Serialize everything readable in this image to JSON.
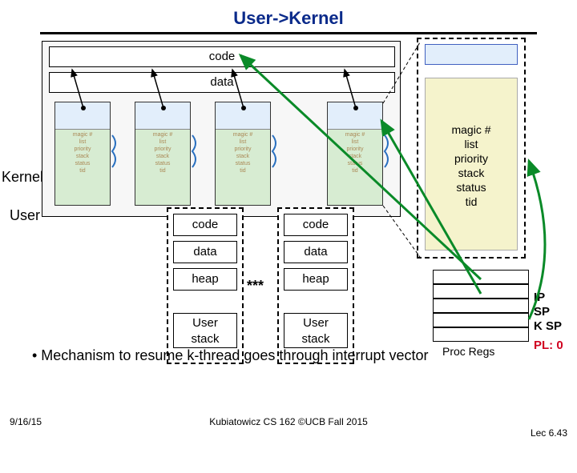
{
  "title": "User->Kernel",
  "kernel_top": {
    "code": "code",
    "data": "data"
  },
  "seg_text": "magic #\nlist\npriority\nstack\nstatus\ntid",
  "right_block": "magic #\nlist\npriority\nstack\nstatus\ntid",
  "user_cols": {
    "left": {
      "code": "code",
      "data": "data",
      "heap": "heap",
      "stack": "User\nstack"
    },
    "right": {
      "code": "code",
      "data": "data",
      "heap": "heap",
      "stack": "User\nstack"
    }
  },
  "asterisks": "***",
  "side": {
    "kernel": "Kernel",
    "user": "User"
  },
  "regs": {
    "ip": "IP",
    "sp": "SP",
    "ksp": "K SP",
    "pl": "PL: 0",
    "label": "Proc Regs"
  },
  "bullet": "• Mechanism to resume k-thread goes through interrupt vector",
  "footer": {
    "left": "9/16/15",
    "center": "Kubiatowicz CS 162 ©UCB Fall 2015",
    "right": "Lec 6.43"
  }
}
